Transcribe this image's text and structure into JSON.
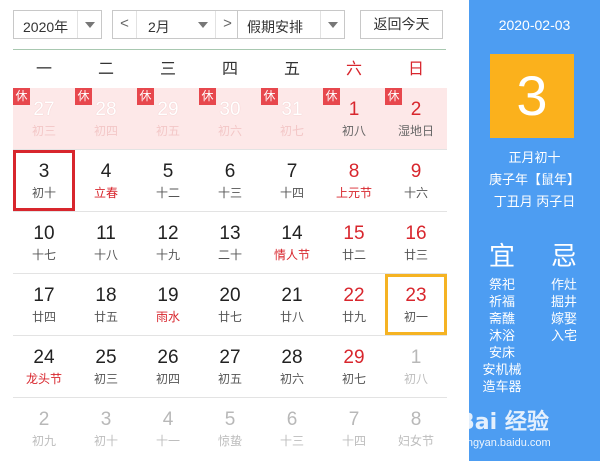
{
  "toolbar": {
    "year": "2020年",
    "month": "2月",
    "holiday_select": "假期安排",
    "today_button": "返回今天",
    "prev_arrow": "<",
    "next_arrow": ">"
  },
  "weekdays": [
    "一",
    "二",
    "三",
    "四",
    "五",
    "六",
    "日"
  ],
  "rest_label": "休",
  "weeks": [
    [
      {
        "day": "27",
        "lunar": "初三",
        "state": "holiday"
      },
      {
        "day": "28",
        "lunar": "初四",
        "state": "holiday"
      },
      {
        "day": "29",
        "lunar": "初五",
        "state": "holiday"
      },
      {
        "day": "30",
        "lunar": "初六",
        "state": "holiday"
      },
      {
        "day": "31",
        "lunar": "初七",
        "state": "holiday"
      },
      {
        "day": "1",
        "lunar": "初八",
        "state": "holiday-accent"
      },
      {
        "day": "2",
        "lunar": "湿地日",
        "state": "holiday-accent"
      }
    ],
    [
      {
        "day": "3",
        "lunar": "初十",
        "state": "today"
      },
      {
        "day": "4",
        "lunar": "立春",
        "state": "fest"
      },
      {
        "day": "5",
        "lunar": "十二",
        "state": ""
      },
      {
        "day": "6",
        "lunar": "十三",
        "state": ""
      },
      {
        "day": "7",
        "lunar": "十四",
        "state": ""
      },
      {
        "day": "8",
        "lunar": "上元节",
        "state": "weekend-fest"
      },
      {
        "day": "9",
        "lunar": "十六",
        "state": "weekend"
      }
    ],
    [
      {
        "day": "10",
        "lunar": "十七",
        "state": ""
      },
      {
        "day": "11",
        "lunar": "十八",
        "state": ""
      },
      {
        "day": "12",
        "lunar": "十九",
        "state": ""
      },
      {
        "day": "13",
        "lunar": "二十",
        "state": ""
      },
      {
        "day": "14",
        "lunar": "情人节",
        "state": "fest"
      },
      {
        "day": "15",
        "lunar": "廿二",
        "state": "weekend"
      },
      {
        "day": "16",
        "lunar": "廿三",
        "state": "weekend"
      }
    ],
    [
      {
        "day": "17",
        "lunar": "廿四",
        "state": ""
      },
      {
        "day": "18",
        "lunar": "廿五",
        "state": ""
      },
      {
        "day": "19",
        "lunar": "雨水",
        "state": "fest"
      },
      {
        "day": "20",
        "lunar": "廿七",
        "state": ""
      },
      {
        "day": "21",
        "lunar": "廿八",
        "state": ""
      },
      {
        "day": "22",
        "lunar": "廿九",
        "state": "weekend"
      },
      {
        "day": "23",
        "lunar": "初一",
        "state": "selected"
      }
    ],
    [
      {
        "day": "24",
        "lunar": "龙头节",
        "state": "fest"
      },
      {
        "day": "25",
        "lunar": "初三",
        "state": ""
      },
      {
        "day": "26",
        "lunar": "初四",
        "state": ""
      },
      {
        "day": "27",
        "lunar": "初五",
        "state": ""
      },
      {
        "day": "28",
        "lunar": "初六",
        "state": ""
      },
      {
        "day": "29",
        "lunar": "初七",
        "state": "weekend"
      },
      {
        "day": "1",
        "lunar": "初八",
        "state": "other"
      }
    ],
    [
      {
        "day": "2",
        "lunar": "初九",
        "state": "other"
      },
      {
        "day": "3",
        "lunar": "初十",
        "state": "other"
      },
      {
        "day": "4",
        "lunar": "十一",
        "state": "other"
      },
      {
        "day": "5",
        "lunar": "惊蛰",
        "state": "other"
      },
      {
        "day": "6",
        "lunar": "十三",
        "state": "other"
      },
      {
        "day": "7",
        "lunar": "十四",
        "state": "other"
      },
      {
        "day": "8",
        "lunar": "妇女节",
        "state": "other"
      }
    ]
  ],
  "panel": {
    "date": "2020-02-03",
    "big_day": "3",
    "lunar_date": "正月初十",
    "year_line": "庚子年【鼠年】",
    "month_day_line": "丁丑月 丙子日",
    "yi_title": "宜",
    "ji_title": "忌",
    "yi_items": [
      "祭祀",
      "祈福",
      "斋醮",
      "沐浴",
      "安床",
      "安机械",
      "造车器"
    ],
    "ji_items": [
      "作灶",
      "掘井",
      "嫁娶",
      "入宅"
    ]
  },
  "watermark": {
    "logo_text": "Bai 经验",
    "url": "jingyan.baidu.com"
  },
  "colors": {
    "panel_bg": "#4d9df2",
    "big_day_bg": "#fbb11c",
    "holiday_bg": "#fde8e8",
    "weekend_red": "#d8262d",
    "today_border": "#d8262d",
    "selected_border": "#f5b323"
  }
}
